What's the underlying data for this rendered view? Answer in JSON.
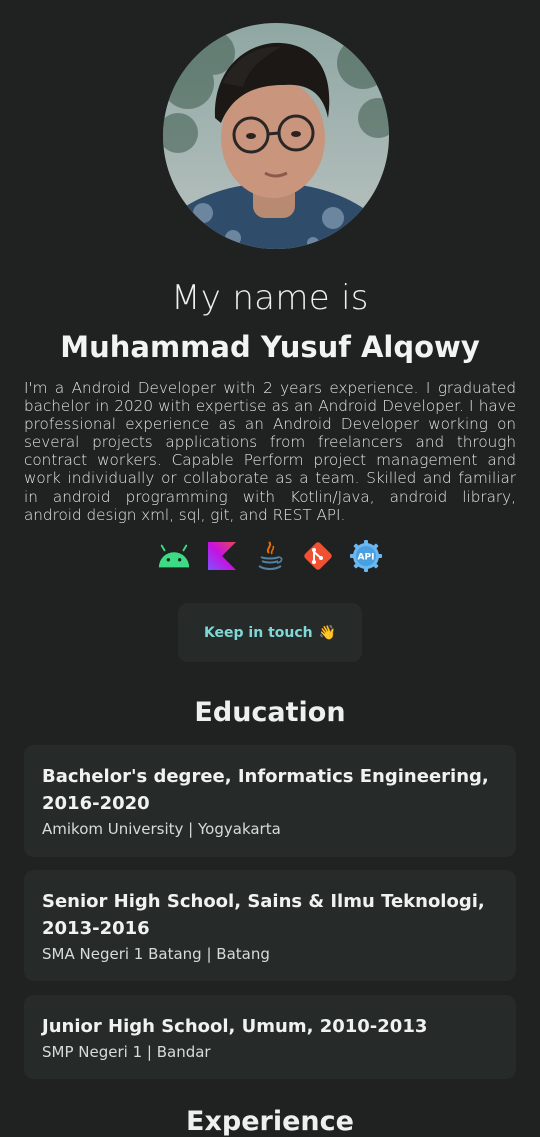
{
  "profile": {
    "greeting": "My name is",
    "name": "Muhammad Yusuf Alqowy",
    "bio": "I'm a Android Developer with 2 years experience. I graduated bachelor in 2020 with expertise as an Android Developer. I have professional experience as an Android Developer working on several projects applications from freelancers and through contract workers. Capable Perform project management and work individually or collaborate as a team. Skilled and familiar in android programming with Kotlin/Java, android library, android design xml, sql, git, and REST API."
  },
  "tech_icons": [
    "android-icon",
    "kotlin-icon",
    "java-icon",
    "git-icon",
    "api-icon"
  ],
  "api_icon_label": "API",
  "contact_button": {
    "label": "Keep in touch",
    "emoji": "👋"
  },
  "education": {
    "title": "Education",
    "items": [
      {
        "degree": "Bachelor's degree, Informatics Engineering, 2016-2020",
        "school": "Amikom University | Yogyakarta"
      },
      {
        "degree": "Senior High School, Sains & Ilmu Teknologi, 2013-2016",
        "school": "SMA Negeri 1 Batang | Batang"
      },
      {
        "degree": "Junior High School, Umum, 2010-2013",
        "school": "SMP Negeri 1 | Bandar"
      }
    ]
  },
  "experience": {
    "title": "Experience"
  },
  "colors": {
    "background": "#1f2221",
    "card": "#262b2a",
    "accent": "#7fd8d6",
    "android": "#3ddc84",
    "git": "#f05133"
  }
}
